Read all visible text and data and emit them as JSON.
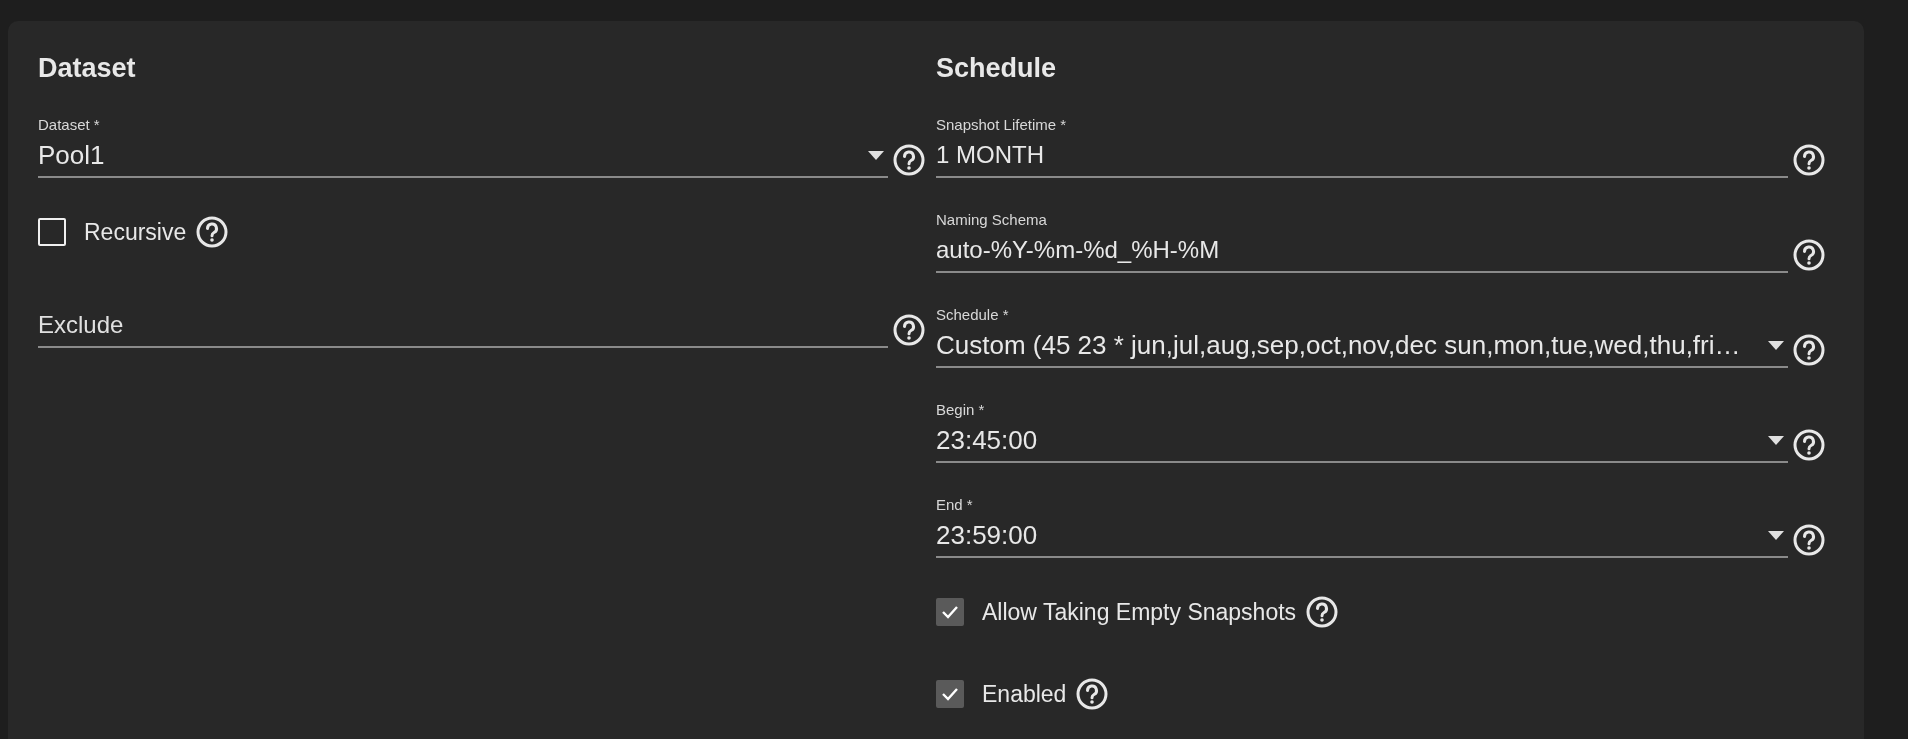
{
  "left": {
    "title": "Dataset",
    "fields": [
      {
        "kind": "select",
        "label": "Dataset *",
        "value": "Pool1"
      },
      {
        "kind": "checkbox",
        "label": "Recursive",
        "checked": false
      },
      {
        "kind": "input",
        "placeholder": "Exclude"
      }
    ]
  },
  "right": {
    "title": "Schedule",
    "fields": [
      {
        "kind": "input",
        "label": "Snapshot Lifetime *",
        "value": "1 MONTH"
      },
      {
        "kind": "input",
        "label": "Naming Schema",
        "value": "auto-%Y-%m-%d_%H-%M"
      },
      {
        "kind": "select",
        "label": "Schedule *",
        "value": "Custom (45 23 * jun,jul,aug,sep,oct,nov,dec sun,mon,tue,wed,thu,fri…"
      },
      {
        "kind": "select",
        "label": "Begin *",
        "value": "23:45:00"
      },
      {
        "kind": "select",
        "label": "End *",
        "value": "23:59:00"
      },
      {
        "kind": "checkbox",
        "label": "Allow Taking Empty Snapshots",
        "checked": true
      },
      {
        "kind": "checkbox",
        "label": "Enabled",
        "checked": true
      }
    ]
  }
}
